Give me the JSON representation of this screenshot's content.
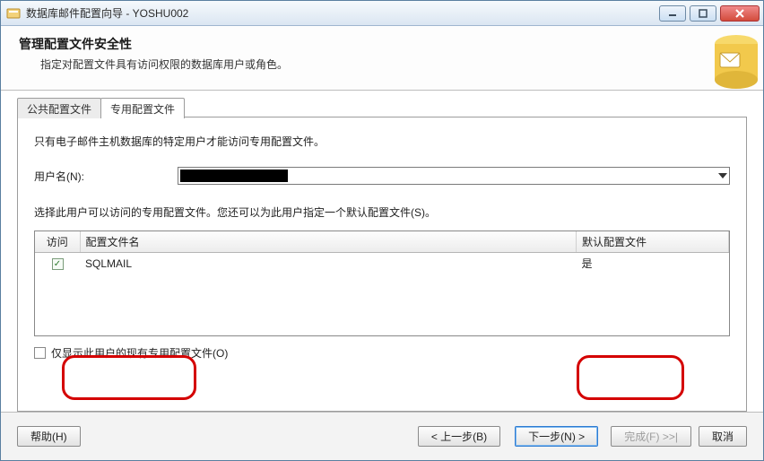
{
  "window": {
    "title": "数据库邮件配置向导 - YOSHU002"
  },
  "header": {
    "title": "管理配置文件安全性",
    "subtitle": "指定对配置文件具有访问权限的数据库用户或角色。"
  },
  "tabs": {
    "public": "公共配置文件",
    "private": "专用配置文件"
  },
  "panel": {
    "info": "只有电子邮件主机数据库的特定用户才能访问专用配置文件。",
    "username_label": "用户名(N):",
    "username_value": "",
    "select_line": "选择此用户可以访问的专用配置文件。您还可以为此用户指定一个默认配置文件(S)。",
    "table": {
      "headers": {
        "access": "访问",
        "name": "配置文件名",
        "default": "默认配置文件"
      },
      "rows": [
        {
          "access_checked": true,
          "name": "SQLMAIL",
          "default": "是"
        }
      ]
    },
    "show_only_label": "仅显示此用户的现有专用配置文件(O)"
  },
  "footer": {
    "help": "帮助(H)",
    "back": "< 上一步(B)",
    "next": "下一步(N) >",
    "finish": "完成(F) >>|",
    "cancel": "取消"
  }
}
